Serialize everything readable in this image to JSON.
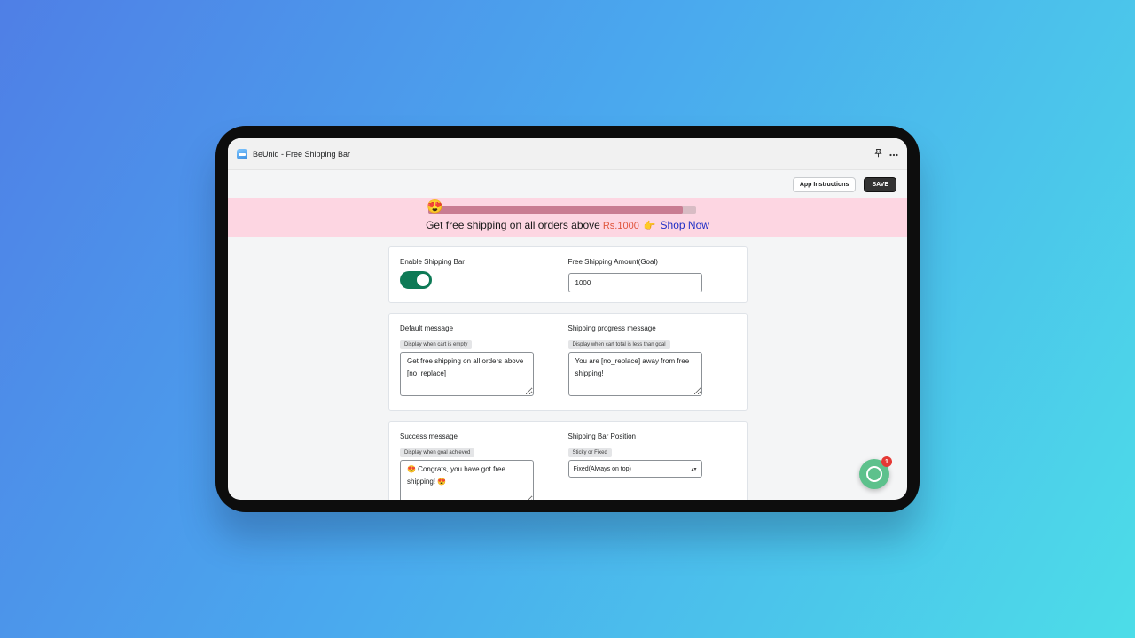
{
  "window": {
    "title": "BeUniq - Free Shipping Bar",
    "icons": [
      "app-icon",
      "pin-icon",
      "more-icon"
    ]
  },
  "toolbar": {
    "instructions_label": "App Instructions",
    "save_label": "SAVE"
  },
  "promo_bar": {
    "text": "Get free shipping on all orders above",
    "amount": "Rs.1000",
    "hand": "👉",
    "link": "Shop Now",
    "progress": 0.95,
    "progress_emoji": "😍",
    "colors": {
      "background": "#fdd6e2",
      "amount": "#e0553d",
      "link": "#1f2ec6"
    }
  },
  "settings": {
    "enable": {
      "label": "Enable Shipping Bar",
      "enabled": true,
      "color": "#0e7a56"
    },
    "goal": {
      "label": "Free Shipping Amount(Goal)",
      "value": "1000"
    },
    "default_message": {
      "label": "Default message",
      "hint": "Display when cart is empty",
      "value": "Get free shipping on all orders above [no_replace]"
    },
    "progress_message": {
      "label": "Shipping progress message",
      "hint": "Display when cart total is less than goal",
      "value": "You are [no_replace] away from free shipping!"
    },
    "success_message": {
      "label": "Success message",
      "hint": "Display when goal achieved",
      "value": "😍 Congrats, you have got free shipping! 😍"
    },
    "position": {
      "label": "Shipping Bar Position",
      "hint": "Sticky or Fixed",
      "selected": "Fixed(Always on top)"
    }
  },
  "chat": {
    "badge": "1",
    "color": "#5dc18c"
  }
}
